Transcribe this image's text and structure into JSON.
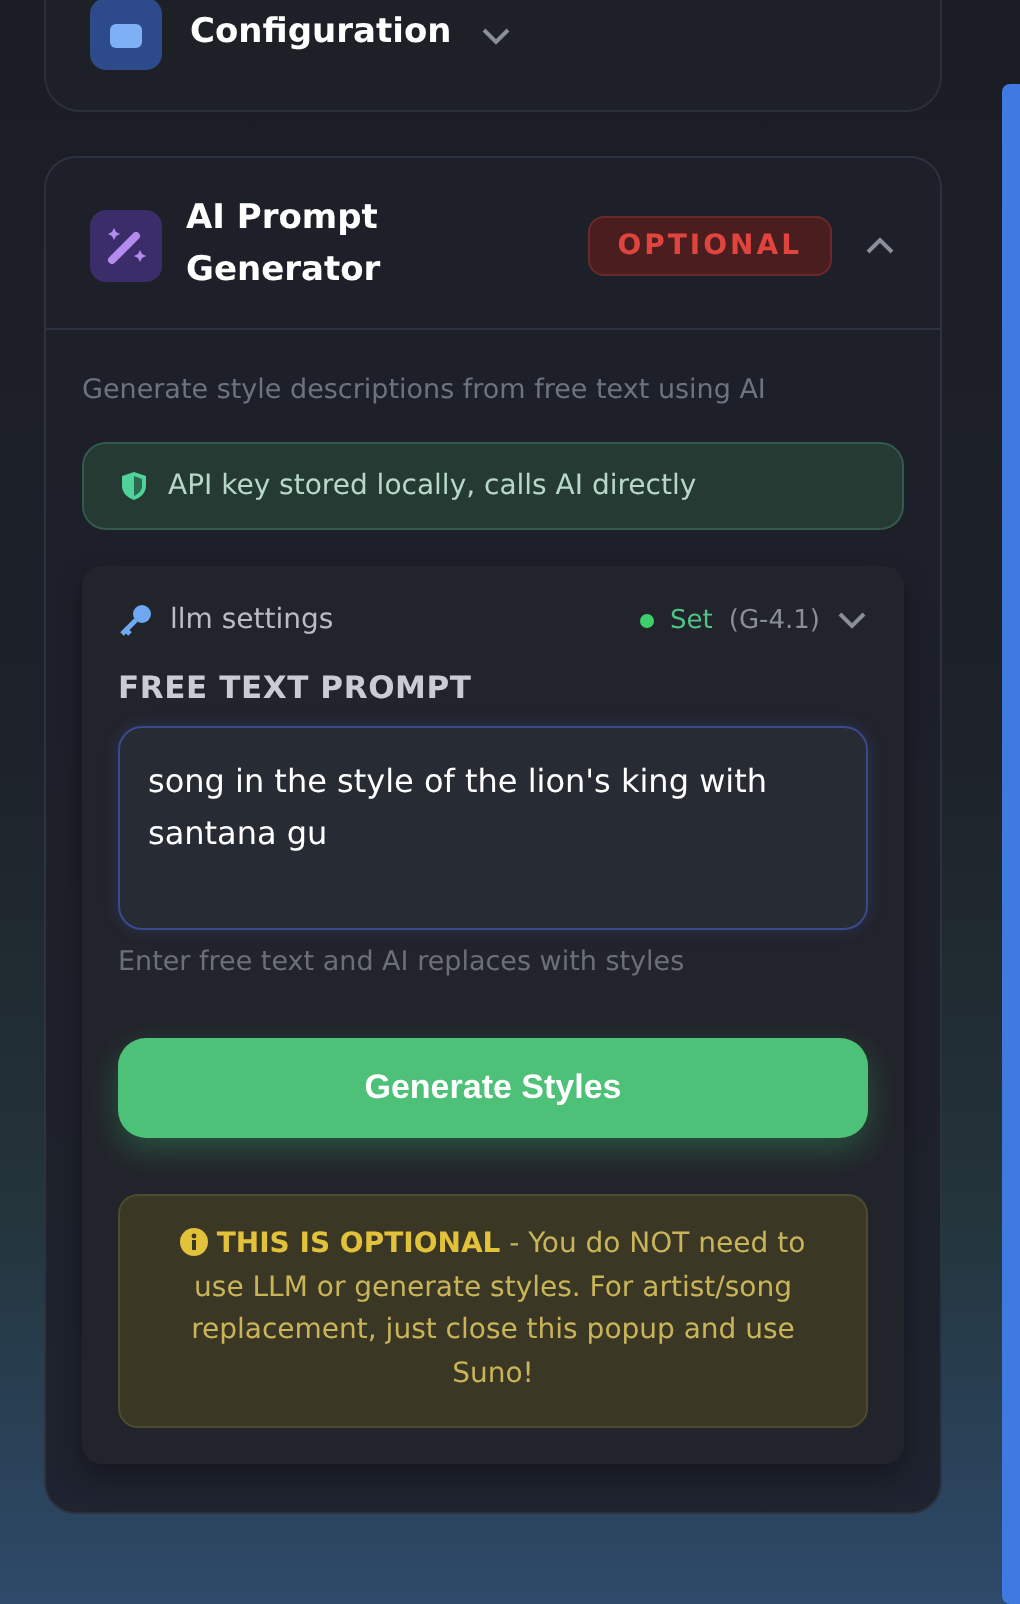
{
  "top_card": {
    "title": "Configuration",
    "expanded": false
  },
  "section": {
    "title": "AI Prompt Generator",
    "badge": "OPTIONAL",
    "expanded": true
  },
  "description": "Generate style descriptions from free text using AI",
  "notice": "API key stored locally, calls AI directly",
  "llm": {
    "label": "llm settings",
    "status": "Set",
    "model": "(G-4.1)",
    "status_on": true,
    "expanded": false
  },
  "prompt": {
    "label": "FREE TEXT PROMPT",
    "value": "song in the style of the lion's king with santana gu",
    "hint": "Enter free text and AI replaces with styles"
  },
  "button": "Generate Styles",
  "warning": "**THIS IS OPTIONAL** - You do NOT need to use LLM or generate styles. For artist/song replacement, just close this popup and use Suno!"
}
